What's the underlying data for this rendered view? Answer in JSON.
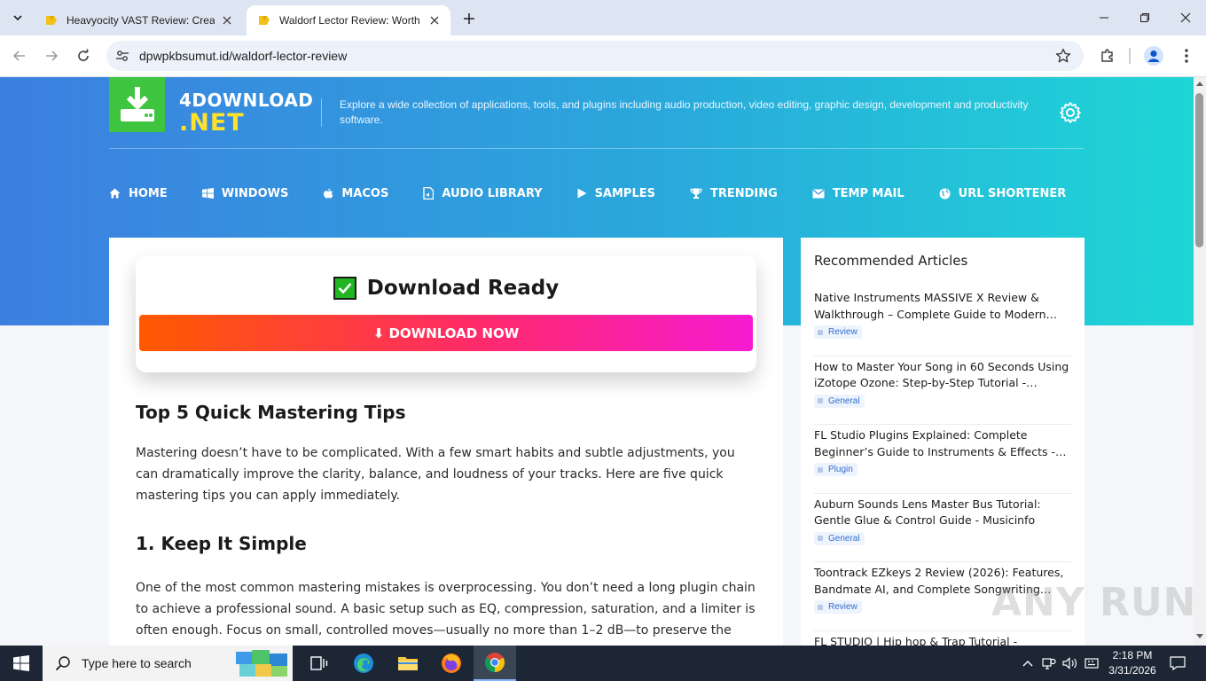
{
  "browser": {
    "tabs": [
      {
        "title": "Heavyocity VAST Review: Creat",
        "active": false
      },
      {
        "title": "Waldorf Lector Review: Worth It",
        "active": true
      }
    ],
    "url": "dpwpkbsumut.id/waldorf-lector-review"
  },
  "site": {
    "logo_line1": "4DOWNLOAD",
    "logo_line2": ".NET",
    "tagline": "Explore a wide collection of applications, tools, and plugins including audio production, video editing, graphic design, development and productivity software.",
    "nav": [
      "HOME",
      "WINDOWS",
      "MACOS",
      "AUDIO LIBRARY",
      "SAMPLES",
      "TRENDING",
      "TEMP MAIL",
      "URL SHORTENER"
    ]
  },
  "download": {
    "title": "Download Ready",
    "button": "⬇ DOWNLOAD NOW"
  },
  "article": {
    "heading": "Top 5 Quick Mastering Tips",
    "intro": "Mastering doesn’t have to be complicated. With a few smart habits and subtle adjustments, you can dramatically improve the clarity, balance, and loudness of your tracks. Here are five quick mastering tips you can apply immediately.",
    "section1_title": "1. Keep It Simple",
    "section1_text": "One of the most common mastering mistakes is overprocessing. You don’t need a long plugin chain to achieve a professional sound. A basic setup such as EQ, compression, saturation, and a limiter is often enough. Focus on small, controlled moves—usually no more than 1–2 dB—to preserve the"
  },
  "sidebar": {
    "title": "Recommended Articles",
    "items": [
      {
        "title": "Native Instruments MASSIVE X Review & Walkthrough – Complete Guide to Modern…",
        "tag": "Review"
      },
      {
        "title": "How to Master Your Song in 60 Seconds Using iZotope Ozone: Step-by-Step Tutorial -…",
        "tag": "General"
      },
      {
        "title": "FL Studio Plugins Explained: Complete Beginner’s Guide to Instruments & Effects -…",
        "tag": "Plugin"
      },
      {
        "title": "Auburn Sounds Lens Master Bus Tutorial: Gentle Glue & Control Guide - Musicinfo",
        "tag": "General"
      },
      {
        "title": "Toontrack EZkeys 2 Review (2026): Features, Bandmate AI, and Complete Songwriting…",
        "tag": "Review"
      },
      {
        "title": "FL STUDIO | Hip hop & Trap Tutorial -",
        "tag": ""
      }
    ]
  },
  "watermark": "ANY RUN",
  "taskbar": {
    "search_placeholder": "Type here to search",
    "time": "2:18 PM",
    "date": "3/31/2026"
  },
  "colors": {
    "accent_blue": "#3d7fe0",
    "accent_cyan": "#1ed6d6",
    "logo_green": "#3ec43e",
    "logo_yellow": "#ffe22b",
    "button_start": "#ff5a00",
    "button_end": "#f61bd3"
  }
}
